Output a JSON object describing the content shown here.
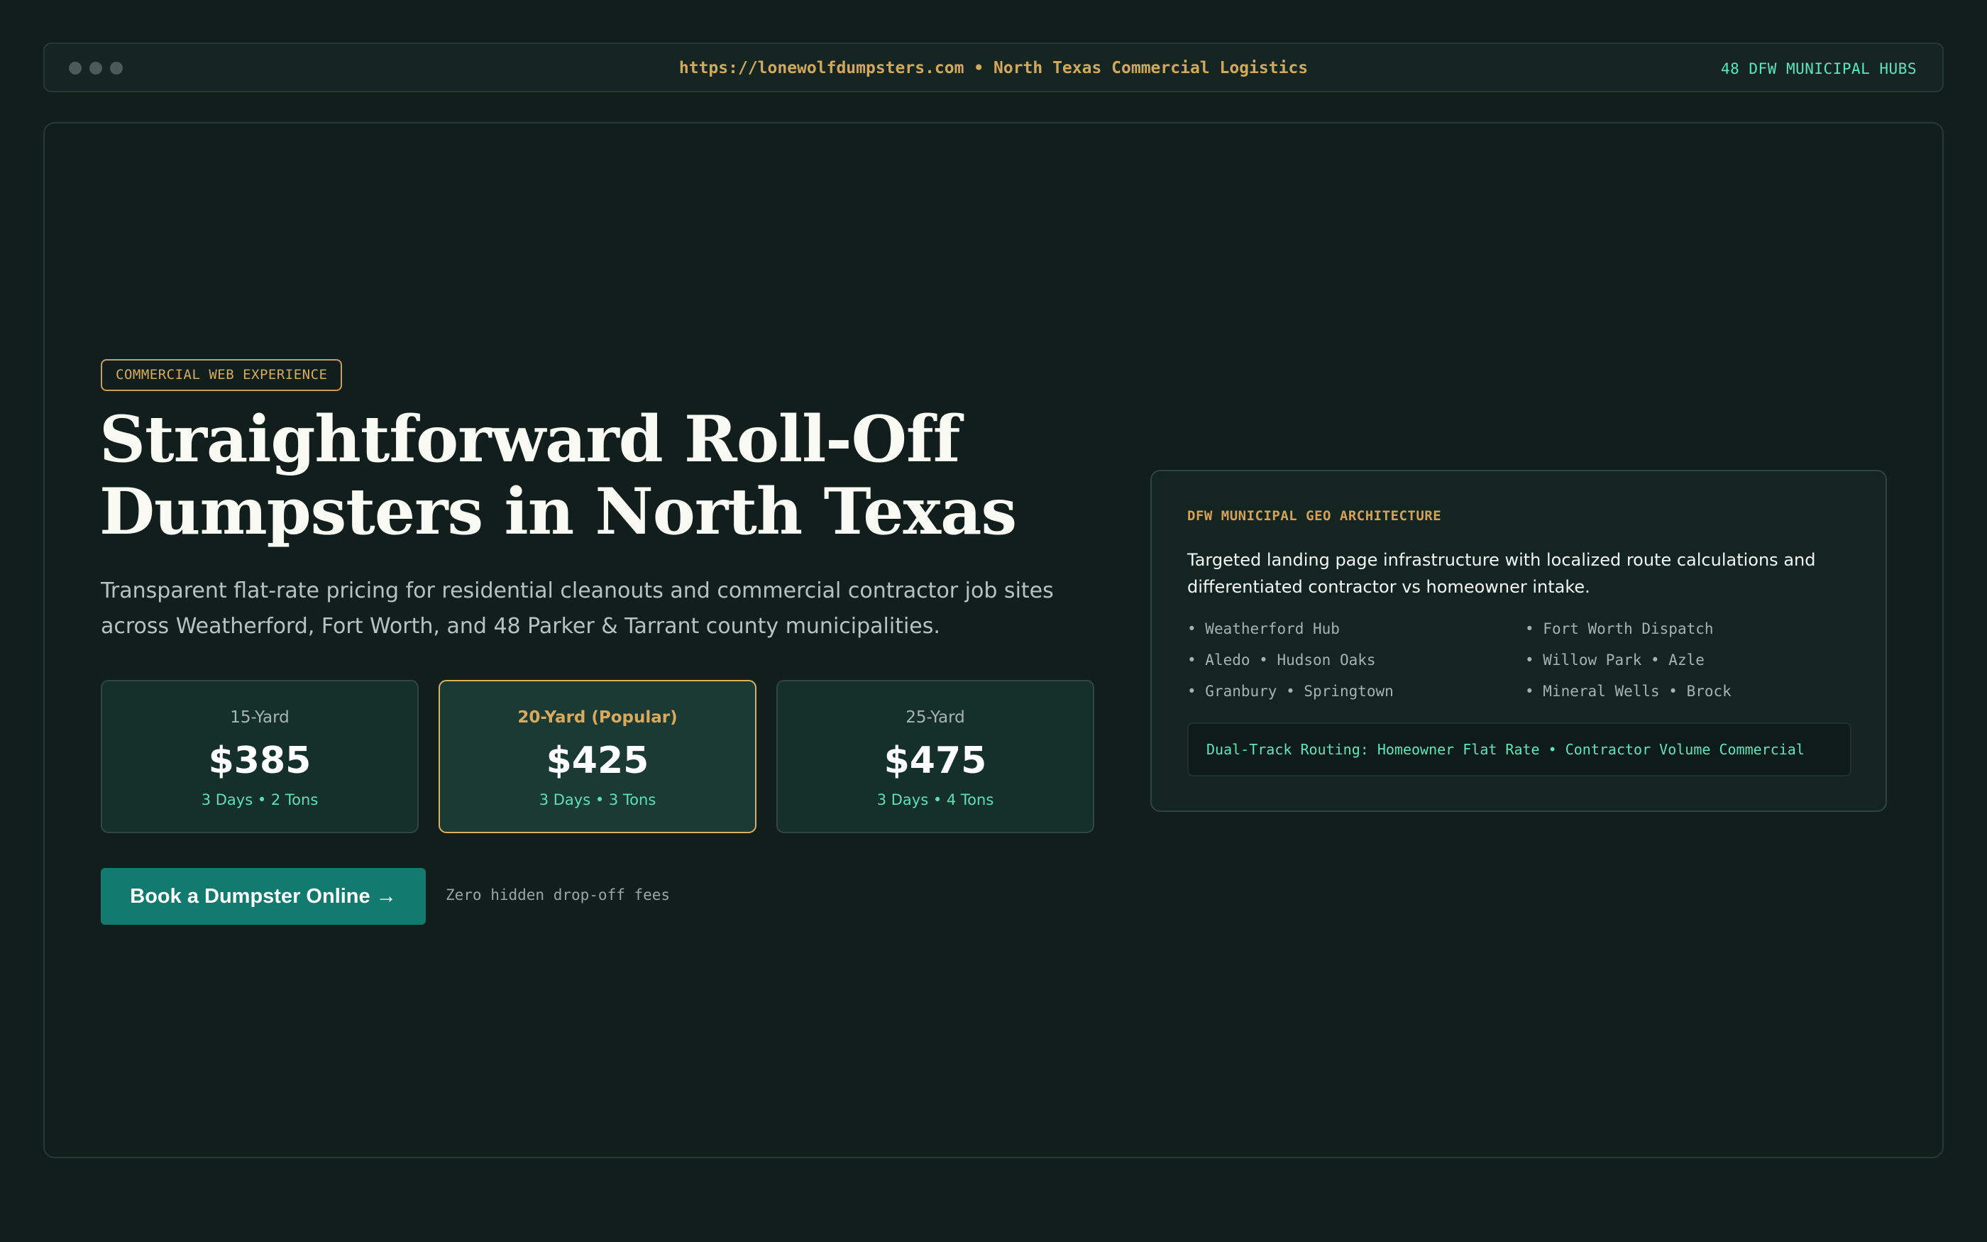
{
  "chrome": {
    "url_text": "https://lonewolfdumpsters.com • North Texas Commercial Logistics",
    "hubs_badge": "48 DFW MUNICIPAL HUBS"
  },
  "hero": {
    "badge": "COMMERCIAL WEB EXPERIENCE",
    "headline_line1": "Straightforward Roll-Off",
    "headline_line2": "Dumpsters in North Texas",
    "subtext": "Transparent flat-rate pricing for residential cleanouts and commercial contractor job sites across Weatherford, Fort Worth, and 48 Parker & Tarrant county municipalities."
  },
  "pricing": [
    {
      "label": "15-Yard",
      "price": "$385",
      "detail": "3 Days • 2 Tons",
      "popular": false
    },
    {
      "label": "20-Yard (Popular)",
      "price": "$425",
      "detail": "3 Days • 3 Tons",
      "popular": true
    },
    {
      "label": "25-Yard",
      "price": "$475",
      "detail": "3 Days • 4 Tons",
      "popular": false
    }
  ],
  "cta": {
    "button_label": "Book a Dumpster Online →",
    "note": "Zero hidden drop-off fees"
  },
  "panel": {
    "title": "DFW MUNICIPAL GEO ARCHITECTURE",
    "description": "Targeted landing page infrastructure with localized route calculations and differentiated contractor vs homeowner intake.",
    "hubs": [
      "Weatherford Hub",
      "Fort Worth Dispatch",
      "Aledo • Hudson Oaks",
      "Willow Park • Azle",
      "Granbury • Springtown",
      "Mineral Wells • Brock"
    ],
    "routing": "Dual-Track Routing: Homeowner Flat Rate • Contractor Volume Commercial"
  },
  "colors": {
    "background": "#111e1c",
    "accent_gold": "#d4a85a",
    "accent_mint": "#5ee6b8",
    "cta_teal": "#127a6e"
  }
}
